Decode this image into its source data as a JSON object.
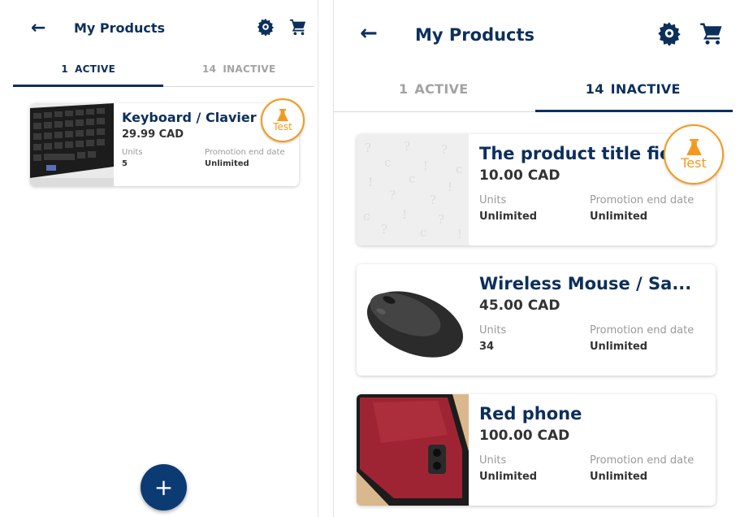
{
  "left": {
    "back_icon": "arrow-left-icon",
    "title": "My Products",
    "tabs": [
      {
        "count": "1",
        "label": "ACTIVE",
        "active": true
      },
      {
        "count": "14",
        "label": "INACTIVE",
        "active": false
      }
    ],
    "products": [
      {
        "name": "Keyboard / Clavier",
        "price": "29.99 CAD",
        "units_label": "Units",
        "units": "5",
        "promo_label": "Promotion end date",
        "promo": "Unlimited",
        "badge": "Test",
        "image": "keyboard"
      }
    ],
    "fab_icon": "plus-icon"
  },
  "right": {
    "back_icon": "arrow-left-icon",
    "title": "My Products",
    "tabs": [
      {
        "count": "1",
        "label": "ACTIVE",
        "active": false
      },
      {
        "count": "14",
        "label": "INACTIVE",
        "active": true
      }
    ],
    "products": [
      {
        "name": "The product title field",
        "price": "10.00 CAD",
        "units_label": "Units",
        "units": "Unlimited",
        "promo_label": "Promotion end date",
        "promo": "Unlimited",
        "badge": "Test",
        "image": "placeholder"
      },
      {
        "name": "Wireless Mouse / Sa...",
        "price": "45.00 CAD",
        "units_label": "Units",
        "units": "34",
        "promo_label": "Promotion end date",
        "promo": "Unlimited",
        "image": "mouse"
      },
      {
        "name": "Red phone",
        "price": "100.00 CAD",
        "units_label": "Units",
        "units": "Unlimited",
        "promo_label": "Promotion end date",
        "promo": "Unlimited",
        "image": "phone"
      }
    ]
  },
  "colors": {
    "primary": "#0c2f5c",
    "fab": "#0c3b73",
    "badge": "#f39a1e",
    "inactive": "#a3a3a3"
  },
  "icons": {
    "settings": "gear-icon",
    "cart": "cart-icon",
    "badge": "flask-icon"
  }
}
